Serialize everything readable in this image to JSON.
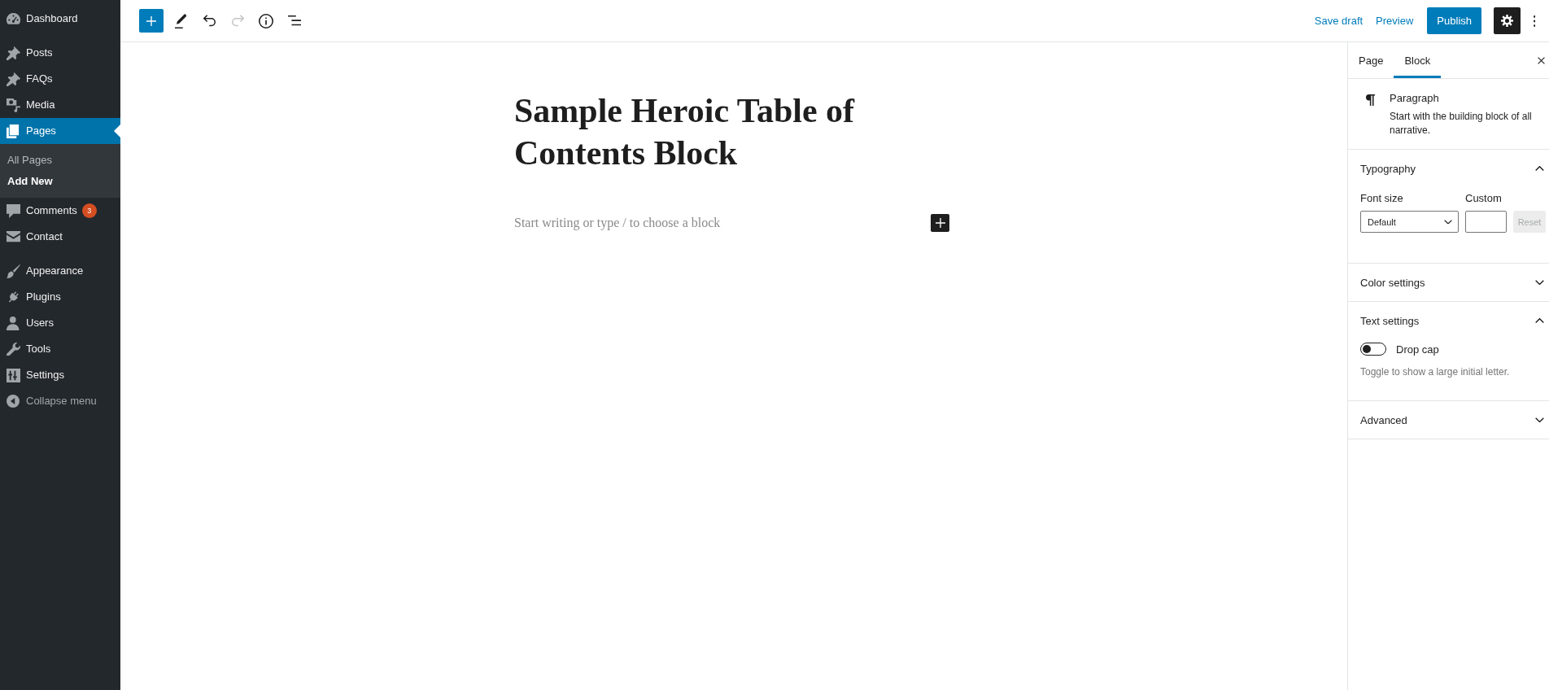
{
  "admin_menu": {
    "groups": [
      {
        "items": [
          {
            "label": "Dashboard",
            "selected": false
          }
        ]
      },
      {
        "items": [
          {
            "label": "Posts",
            "selected": false
          },
          {
            "label": "FAQs",
            "selected": false
          },
          {
            "label": "Media",
            "selected": false
          },
          {
            "label": "Pages",
            "selected": true,
            "children": [
              {
                "label": "All Pages",
                "selected": false
              },
              {
                "label": "Add New",
                "selected": true
              }
            ]
          },
          {
            "label": "Comments",
            "selected": false,
            "badge": "3"
          },
          {
            "label": "Contact",
            "selected": false
          }
        ]
      },
      {
        "items": [
          {
            "label": "Appearance",
            "selected": false
          },
          {
            "label": "Plugins",
            "selected": false
          },
          {
            "label": "Users",
            "selected": false
          },
          {
            "label": "Tools",
            "selected": false
          },
          {
            "label": "Settings",
            "selected": false
          }
        ]
      }
    ],
    "collapse_label": "Collapse menu"
  },
  "editor_toolbar": {
    "tools": [
      {
        "disabled": false
      },
      {
        "disabled": false
      },
      {
        "disabled": false
      },
      {
        "disabled": true
      },
      {
        "disabled": false
      },
      {
        "disabled": false
      }
    ],
    "save_draft": "Save draft",
    "preview": "Preview",
    "publish": "Publish",
    "settings_pressed": true
  },
  "canvas": {
    "title": "Sample Heroic Table of Contents Block",
    "paragraph": {
      "placeholder": "Start writing or type / to choose a block"
    }
  },
  "settings_sidebar": {
    "tabs": [
      {
        "label": "Page",
        "selected": false
      },
      {
        "label": "Block",
        "selected": true
      }
    ],
    "block_card": {
      "title": "Paragraph",
      "description": "Start with the building block of all narrative."
    },
    "panels": [
      {
        "kind": "typography",
        "title": "Typography",
        "expanded": true,
        "font_size_label": "Font size",
        "font_size_value": "Default",
        "custom_label": "Custom",
        "reset_label": "Reset",
        "reset_disabled": true
      },
      {
        "title": "Color settings",
        "expanded": false
      },
      {
        "kind": "text",
        "title": "Text settings",
        "expanded": true,
        "toggle_label": "Drop cap",
        "toggle_on": false,
        "help": "Toggle to show a large initial letter."
      },
      {
        "title": "Advanced",
        "expanded": false
      }
    ]
  }
}
